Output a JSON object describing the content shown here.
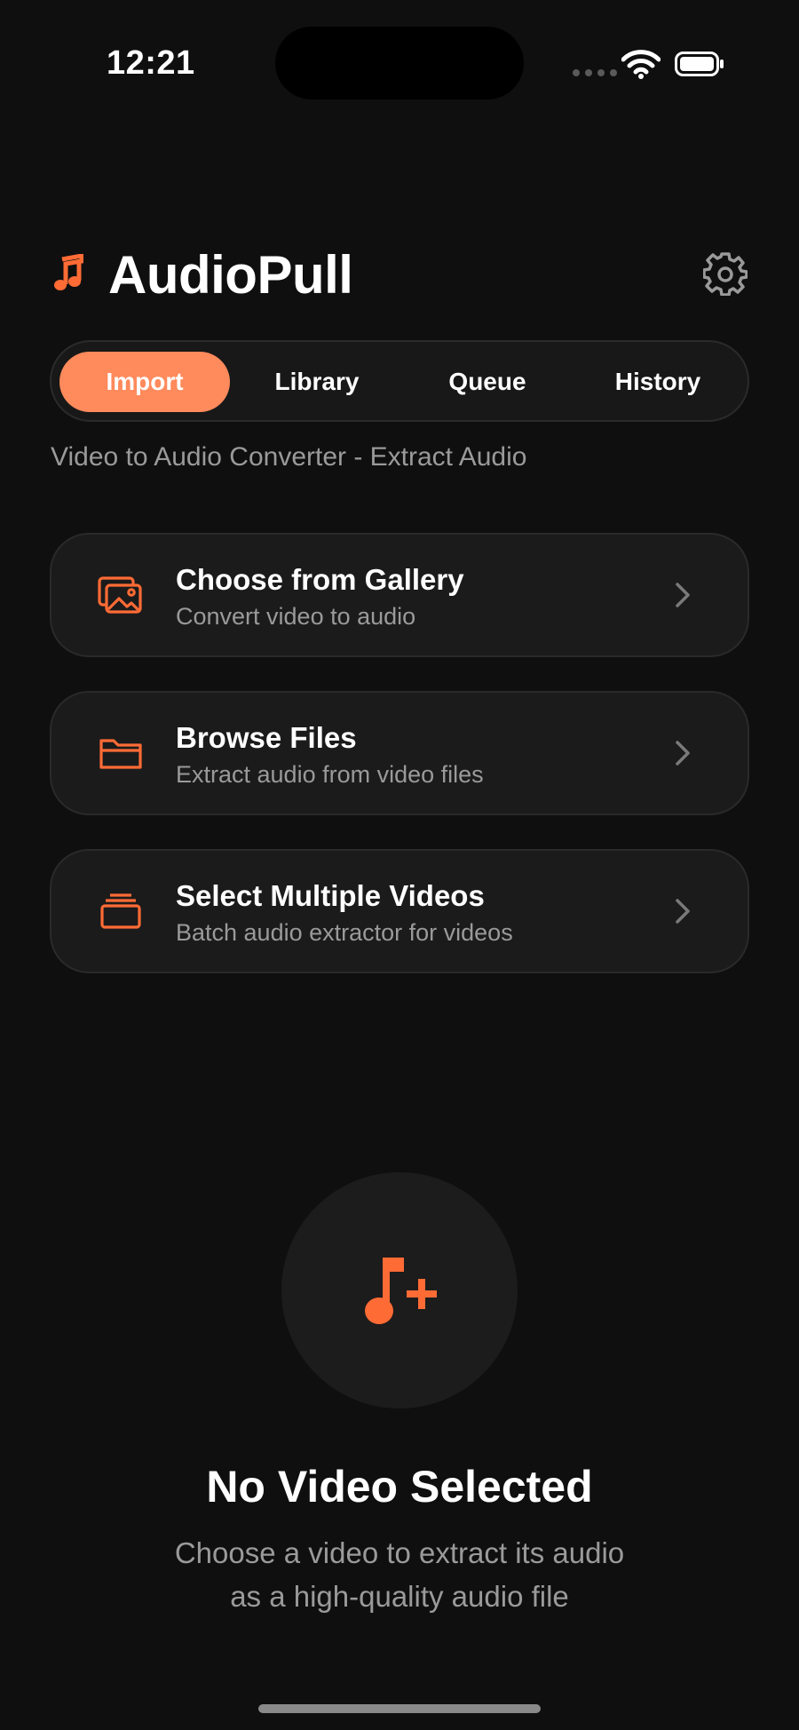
{
  "status_bar": {
    "time": "12:21"
  },
  "header": {
    "app_title": "AudioPull",
    "app_icon": "music-note-icon",
    "settings_icon": "gear-icon"
  },
  "tabs": [
    {
      "label": "Import",
      "active": true
    },
    {
      "label": "Library",
      "active": false
    },
    {
      "label": "Queue",
      "active": false
    },
    {
      "label": "History",
      "active": false
    }
  ],
  "subtitle": "Video to Audio Converter - Extract Audio",
  "options": [
    {
      "title": "Choose from Gallery",
      "subtitle": "Convert video to audio",
      "icon": "photo-gallery-icon"
    },
    {
      "title": "Browse Files",
      "subtitle": "Extract audio from video files",
      "icon": "folder-icon"
    },
    {
      "title": "Select Multiple Videos",
      "subtitle": "Batch audio extractor for videos",
      "icon": "stack-icon"
    }
  ],
  "empty_state": {
    "icon": "music-note-plus-icon",
    "title": "No Video Selected",
    "line1": "Choose a video to extract its audio",
    "line2": "as a high-quality audio file"
  },
  "colors": {
    "accent": "#ff6b35",
    "active_tab": "#ff8a5b",
    "background": "#0f0f0f",
    "card": "#1b1b1b",
    "secondary_text": "#9a9a9a"
  }
}
